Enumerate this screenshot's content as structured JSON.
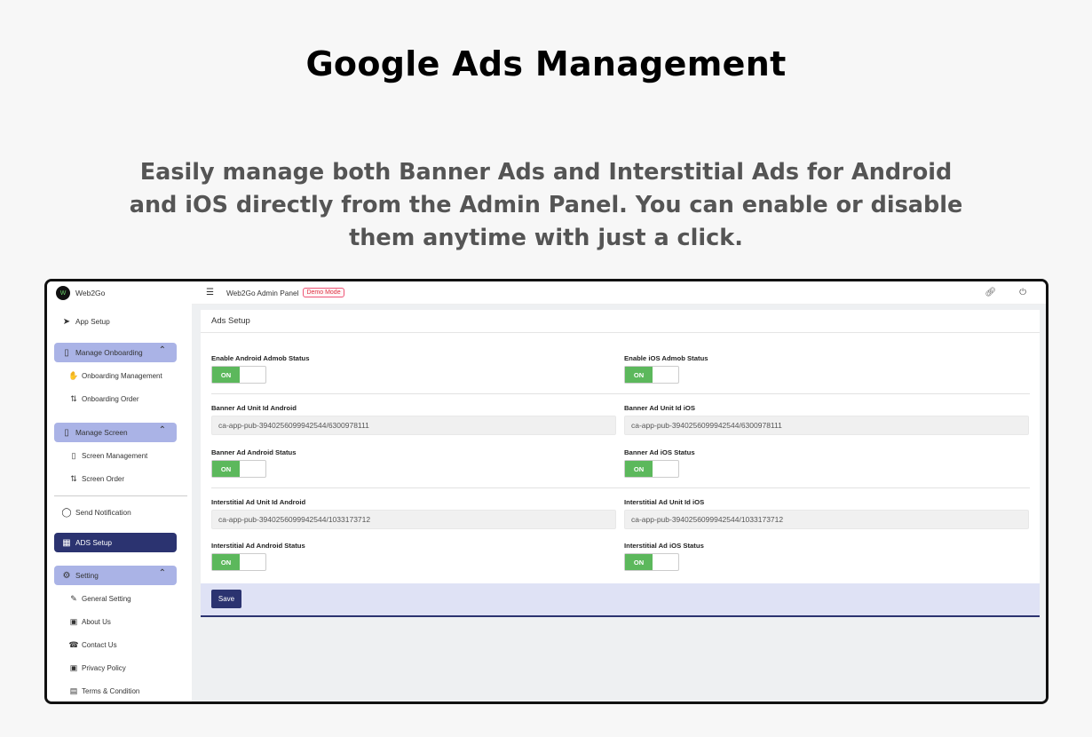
{
  "promo": {
    "title": "Google Ads Management",
    "description": "Easily manage both Banner Ads and Interstitial Ads for Android and iOS directly from the Admin Panel. You can enable or disable them anytime with just a click."
  },
  "brand": {
    "name": "Web2Go",
    "logo_text": "W"
  },
  "topbar": {
    "title": "Web2Go Admin Panel",
    "badge": "Demo Mode",
    "icons": [
      "link-icon",
      "power-icon"
    ]
  },
  "sidebar": {
    "app_setup": "App Setup",
    "manage_onboarding": "Manage Onboarding",
    "onboarding_management": "Onboarding Management",
    "onboarding_order": "Onboarding Order",
    "manage_screen": "Manage Screen",
    "screen_management": "Screen Management",
    "screen_order": "Screen Order",
    "send_notification": "Send Notification",
    "ads_setup": "ADS Setup",
    "setting": "Setting",
    "general_setting": "General Setting",
    "about_us": "About Us",
    "contact_us": "Contact Us",
    "privacy_policy": "Privacy Policy",
    "terms": "Terms & Condition"
  },
  "ads": {
    "title": "Ads Setup",
    "android_admob_label": "Enable Android Admob Status",
    "ios_admob_label": "Enable iOS Admob Status",
    "banner_android_id_label": "Banner Ad Unit Id Android",
    "banner_android_id_value": "ca-app-pub-3940256099942544/6300978111",
    "banner_ios_id_label": "Banner Ad Unit Id iOS",
    "banner_ios_id_value": "ca-app-pub-3940256099942544/6300978111",
    "banner_android_status_label": "Banner Ad Android Status",
    "banner_ios_status_label": "Banner Ad iOS Status",
    "inter_android_id_label": "Interstitial Ad Unit Id Android",
    "inter_android_id_value": "ca-app-pub-3940256099942544/1033173712",
    "inter_ios_id_label": "Interstitial Ad Unit Id iOS",
    "inter_ios_id_value": "ca-app-pub-3940256099942544/1033173712",
    "inter_android_status_label": "Interstitial Ad Android Status",
    "inter_ios_status_label": "Interstitial Ad iOS Status",
    "toggle_on": "ON",
    "save": "Save"
  },
  "colors": {
    "accent": "#2b3370",
    "group_bg": "#aab3e6",
    "toggle_on": "#5cb85c"
  }
}
